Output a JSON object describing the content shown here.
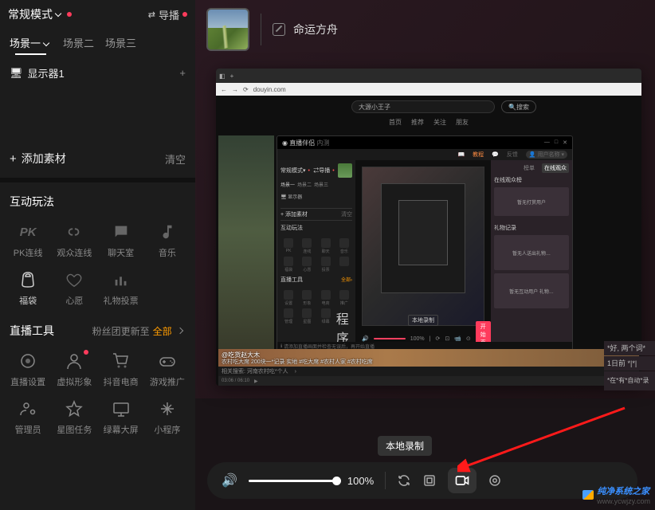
{
  "topbar": {
    "mode": "常规模式",
    "swap": "导播"
  },
  "scenes": {
    "items": [
      "场景一",
      "场景二",
      "场景三"
    ],
    "active": 0
  },
  "monitor": {
    "label": "显示器1"
  },
  "add_source": {
    "label": "添加素材",
    "clear": "清空"
  },
  "interactive": {
    "title": "互动玩法",
    "items": [
      {
        "label": "PK连线"
      },
      {
        "label": "观众连线"
      },
      {
        "label": "聊天室"
      },
      {
        "label": "音乐"
      },
      {
        "label": "福袋"
      },
      {
        "label": "心愿"
      },
      {
        "label": "礼物投票"
      }
    ]
  },
  "tools": {
    "title": "直播工具",
    "more_prefix": "粉丝团更新至",
    "more_all": "全部",
    "items": [
      {
        "label": "直播设置"
      },
      {
        "label": "虚拟形象"
      },
      {
        "label": "抖音电商"
      },
      {
        "label": "游戏推广"
      },
      {
        "label": "管理员"
      },
      {
        "label": "星图任务"
      },
      {
        "label": "绿幕大屏"
      },
      {
        "label": "小程序"
      }
    ]
  },
  "preview_top": {
    "game": "命运方舟"
  },
  "browser": {
    "addr": "douyin.com",
    "search": "大源小王子",
    "search_btn": "搜索",
    "nav_links": [
      "首页",
      "推荐",
      "关注",
      "朋友"
    ]
  },
  "inner": {
    "title": "直播伴侣",
    "subtitle_links": [
      "教程",
      "反馈"
    ],
    "scenes": [
      "场景一",
      "场景二",
      "场景三"
    ],
    "add_src": "+ 添加素材",
    "clear": "清空",
    "panel_items": [
      "PK",
      "连线",
      "聊天",
      "音乐",
      "福袋",
      "心愿",
      "投票",
      "",
      "设置",
      "形象",
      "电商",
      "推广",
      "管理",
      "星图",
      "绿幕",
      "程序"
    ],
    "right_tabs": [
      "榜单",
      "在线观众"
    ],
    "right_hdr": "在线观众榜",
    "right_card1": "暂无打赏用户",
    "sub_label": "本地录制",
    "start_btn": "开始直播",
    "info_line": "请添加直播画面并检查无误后，再开始直播"
  },
  "bw_bottom": {
    "author": "@吃货赵大木",
    "desc": "农村吃大席 200块一*记录 实地 #吃大席 #农村人家 #农村吃席",
    "related": "相关搜索: 河南农村吃*个人",
    "time": "03:06 / 06:10"
  },
  "right_side": {
    "row1": "*好, 两个词*",
    "row2": "1日前 *|*|",
    "row3": "*在*有*自动*录"
  },
  "bottom": {
    "volume": "100%",
    "tooltip": "本地录制"
  },
  "watermark": {
    "brand": "纯净系统之家",
    "url": "www.ycwjzy.com"
  }
}
